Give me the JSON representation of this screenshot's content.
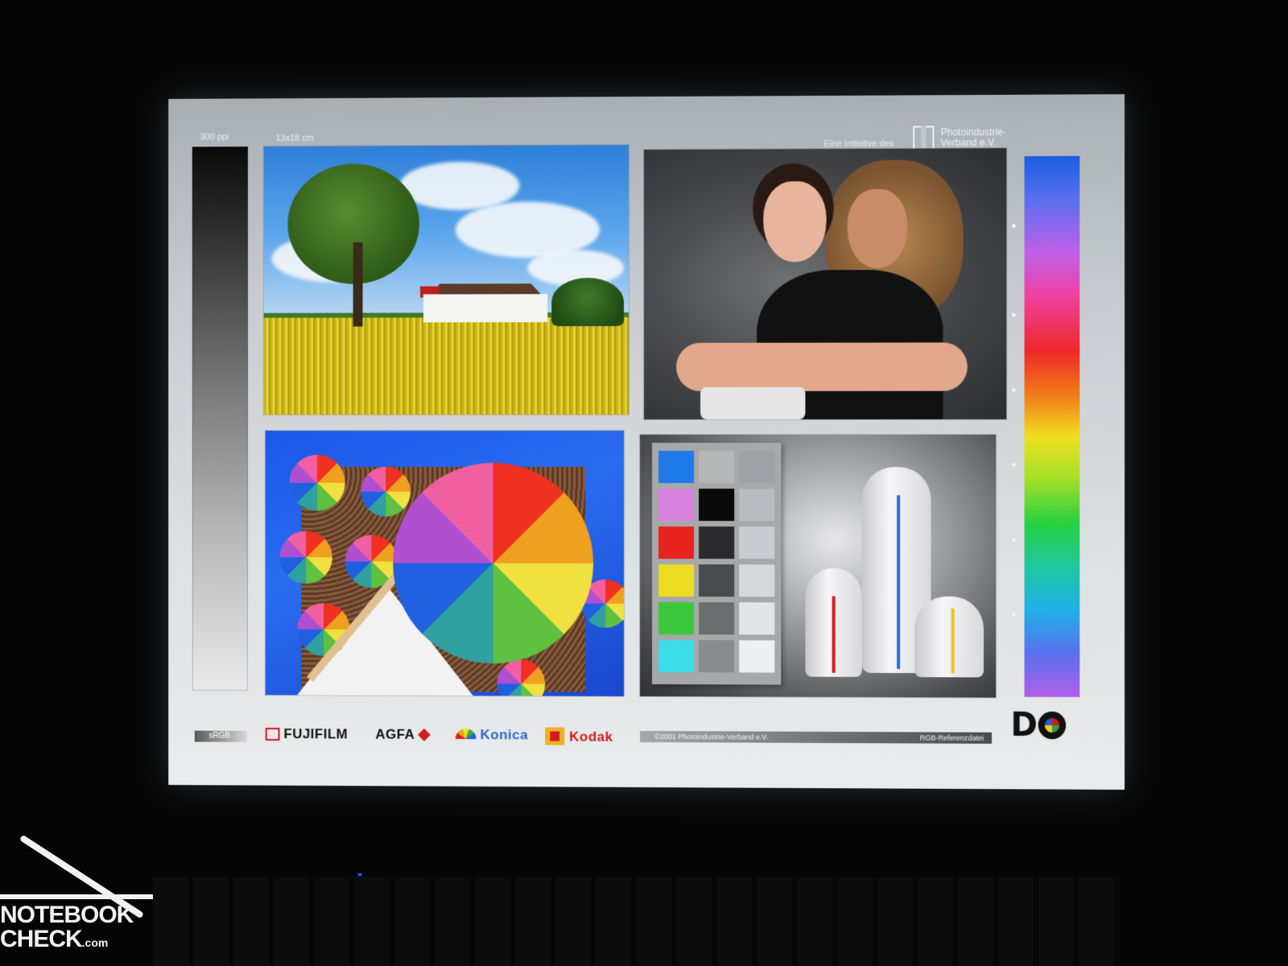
{
  "chart": {
    "ppi": "300 ppi",
    "size": "13x18 cm",
    "initiative": "Eine Initiative des",
    "org_line1": "Photoindustrie-",
    "org_line2": "Verband e.V."
  },
  "footer": {
    "srgb": "sRGB",
    "brands": {
      "fujifilm": "FUJIFILM",
      "agfa": "AGFA",
      "konica": "Konica",
      "kodak": "Kodak"
    },
    "copyright": "©2001 Photoindustrie-Verband e.V.",
    "reference": "RGB-Referenzdatei",
    "logo_d": "D"
  },
  "watermark": {
    "line1": "NOTEBOOK",
    "line2": "CHECK",
    "suffix": ".com"
  },
  "colors": {
    "swatch_left": [
      "#1e7ae8",
      "#d884e0",
      "#e8221e",
      "#ecdc22",
      "#3cc83c",
      "#3cdce8"
    ],
    "swatch_mid": [
      "#b4b6b8",
      "#0a0a0a",
      "#2a2a2c",
      "#4a4b4d",
      "#6c6d6f",
      "#8a8b8d"
    ],
    "swatch_right": [
      "#9ea2a6",
      "#b8bcc0",
      "#c8ccd0",
      "#d6d9dc",
      "#e2e4e6",
      "#eeeff0"
    ]
  },
  "icons": [
    "fujifilm-logo-icon",
    "agfa-logo-icon",
    "konica-logo-icon",
    "kodak-logo-icon",
    "do-logo-icon",
    "notebookcheck-logo-icon"
  ]
}
